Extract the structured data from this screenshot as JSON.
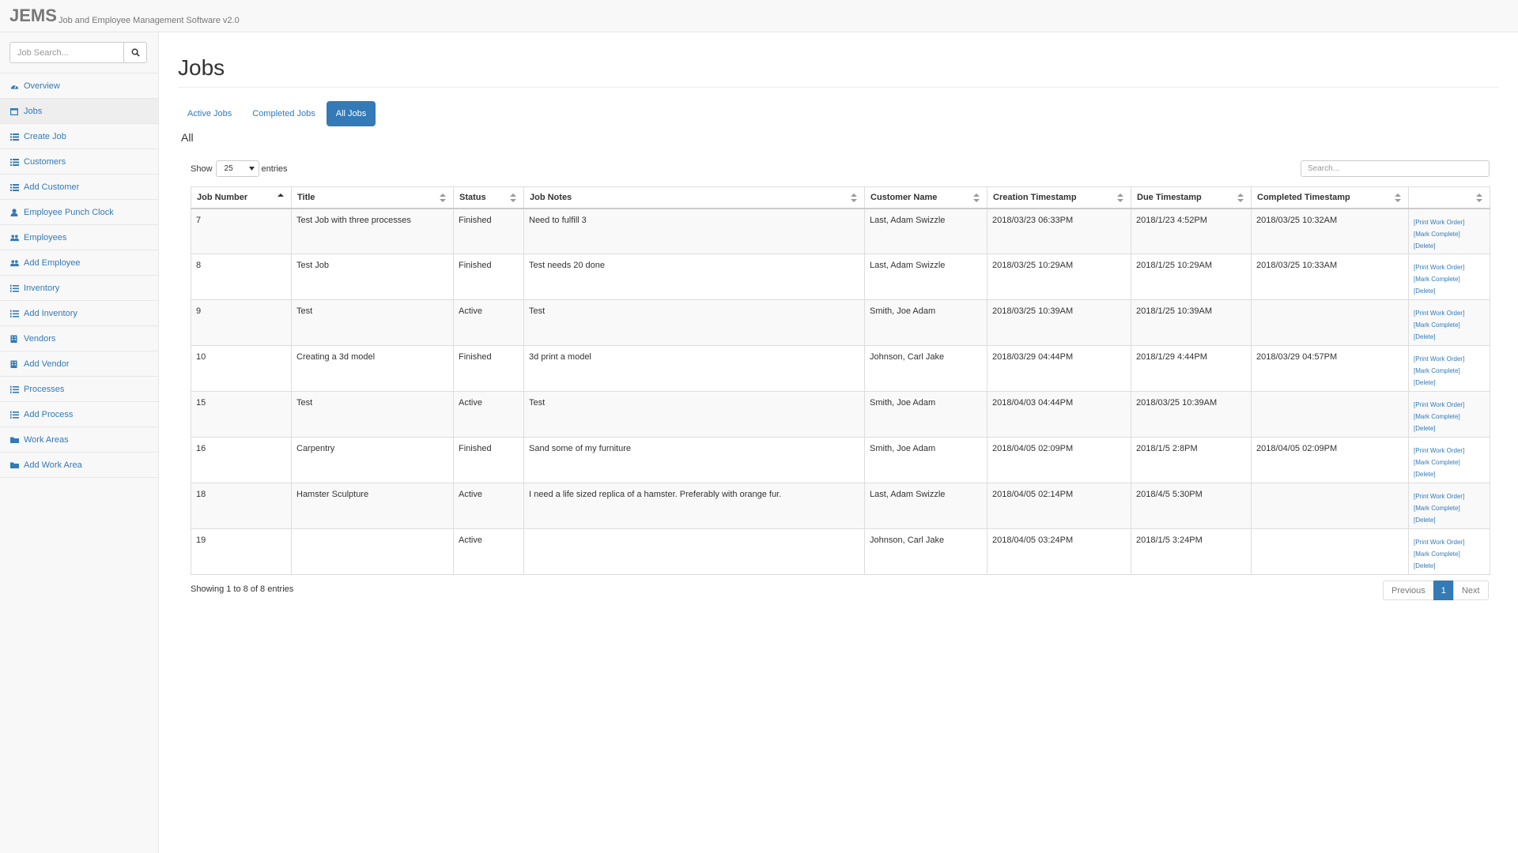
{
  "app": {
    "brand": "JEMS",
    "subtitle": "Job and Employee Management Software v2.0"
  },
  "sidebar": {
    "search_placeholder": "Job Search...",
    "items": [
      {
        "label": "Overview",
        "icon": "dashboard-icon"
      },
      {
        "label": "Jobs",
        "icon": "calendar-icon",
        "active": true
      },
      {
        "label": "Create Job",
        "icon": "list-icon"
      },
      {
        "label": "Customers",
        "icon": "list-icon"
      },
      {
        "label": "Add Customer",
        "icon": "list-icon"
      },
      {
        "label": "Employee Punch Clock",
        "icon": "user-icon"
      },
      {
        "label": "Employees",
        "icon": "users-icon"
      },
      {
        "label": "Add Employee",
        "icon": "users-icon"
      },
      {
        "label": "Inventory",
        "icon": "list-ol-icon"
      },
      {
        "label": "Add Inventory",
        "icon": "list-ol-icon"
      },
      {
        "label": "Vendors",
        "icon": "building-icon"
      },
      {
        "label": "Add Vendor",
        "icon": "building-icon"
      },
      {
        "label": "Processes",
        "icon": "list-ol-icon"
      },
      {
        "label": "Add Process",
        "icon": "list-ol-icon"
      },
      {
        "label": "Work Areas",
        "icon": "folder-icon"
      },
      {
        "label": "Add Work Area",
        "icon": "folder-icon"
      }
    ]
  },
  "main": {
    "title": "Jobs",
    "tabs": [
      {
        "label": "Active Jobs"
      },
      {
        "label": "Completed Jobs"
      },
      {
        "label": "All Jobs",
        "active": true
      }
    ],
    "subtitle": "All"
  },
  "table": {
    "show_label": "Show",
    "page_length": "25",
    "entries_label": "entries",
    "search_placeholder": "Search...",
    "columns": [
      "Job Number",
      "Title",
      "Status",
      "Job Notes",
      "Customer Name",
      "Creation Timestamp",
      "Due Timestamp",
      "Completed Timestamp",
      ""
    ],
    "action_labels": {
      "print": "[Print Work Order]",
      "complete": "[Mark Complete]",
      "delete": "[Delete]"
    },
    "rows": [
      {
        "job_number": "7",
        "title": "Test Job with three processes",
        "status": "Finished",
        "notes": "Need to fulfill 3",
        "customer": "Last, Adam Swizzle",
        "created": "2018/03/23 06:33PM",
        "due": "2018/1/23 4:52PM",
        "completed": "2018/03/25 10:32AM"
      },
      {
        "job_number": "8",
        "title": "Test Job",
        "status": "Finished",
        "notes": "Test needs 20 done",
        "customer": "Last, Adam Swizzle",
        "created": "2018/03/25 10:29AM",
        "due": "2018/1/25 10:29AM",
        "completed": "2018/03/25 10:33AM"
      },
      {
        "job_number": "9",
        "title": "Test",
        "status": "Active",
        "notes": "Test",
        "customer": "Smith, Joe Adam",
        "created": "2018/03/25 10:39AM",
        "due": "2018/1/25 10:39AM",
        "completed": ""
      },
      {
        "job_number": "10",
        "title": "Creating a 3d model",
        "status": "Finished",
        "notes": "3d print a model",
        "customer": "Johnson, Carl Jake",
        "created": "2018/03/29 04:44PM",
        "due": "2018/1/29 4:44PM",
        "completed": "2018/03/29 04:57PM"
      },
      {
        "job_number": "15",
        "title": "Test",
        "status": "Active",
        "notes": "Test",
        "customer": "Smith, Joe Adam",
        "created": "2018/04/03 04:44PM",
        "due": "2018/03/25 10:39AM",
        "completed": ""
      },
      {
        "job_number": "16",
        "title": "Carpentry",
        "status": "Finished",
        "notes": "Sand some of my furniture",
        "customer": "Smith, Joe Adam",
        "created": "2018/04/05 02:09PM",
        "due": "2018/1/5 2:8PM",
        "completed": "2018/04/05 02:09PM"
      },
      {
        "job_number": "18",
        "title": "Hamster Sculpture",
        "status": "Active",
        "notes": "I need a life sized replica of a hamster. Preferably with orange fur.",
        "customer": "Last, Adam Swizzle",
        "created": "2018/04/05 02:14PM",
        "due": "2018/4/5 5:30PM",
        "completed": ""
      },
      {
        "job_number": "19",
        "title": "",
        "status": "Active",
        "notes": "",
        "customer": "Johnson, Carl Jake",
        "created": "2018/04/05 03:24PM",
        "due": "2018/1/5 3:24PM",
        "completed": ""
      }
    ],
    "info": "Showing 1 to 8 of 8 entries",
    "pagination": {
      "previous": "Previous",
      "current": "1",
      "next": "Next"
    }
  },
  "colors": {
    "accent": "#337ab7",
    "sidebar_bg": "#f8f8f8",
    "row_stripe": "#f9f9f9"
  }
}
